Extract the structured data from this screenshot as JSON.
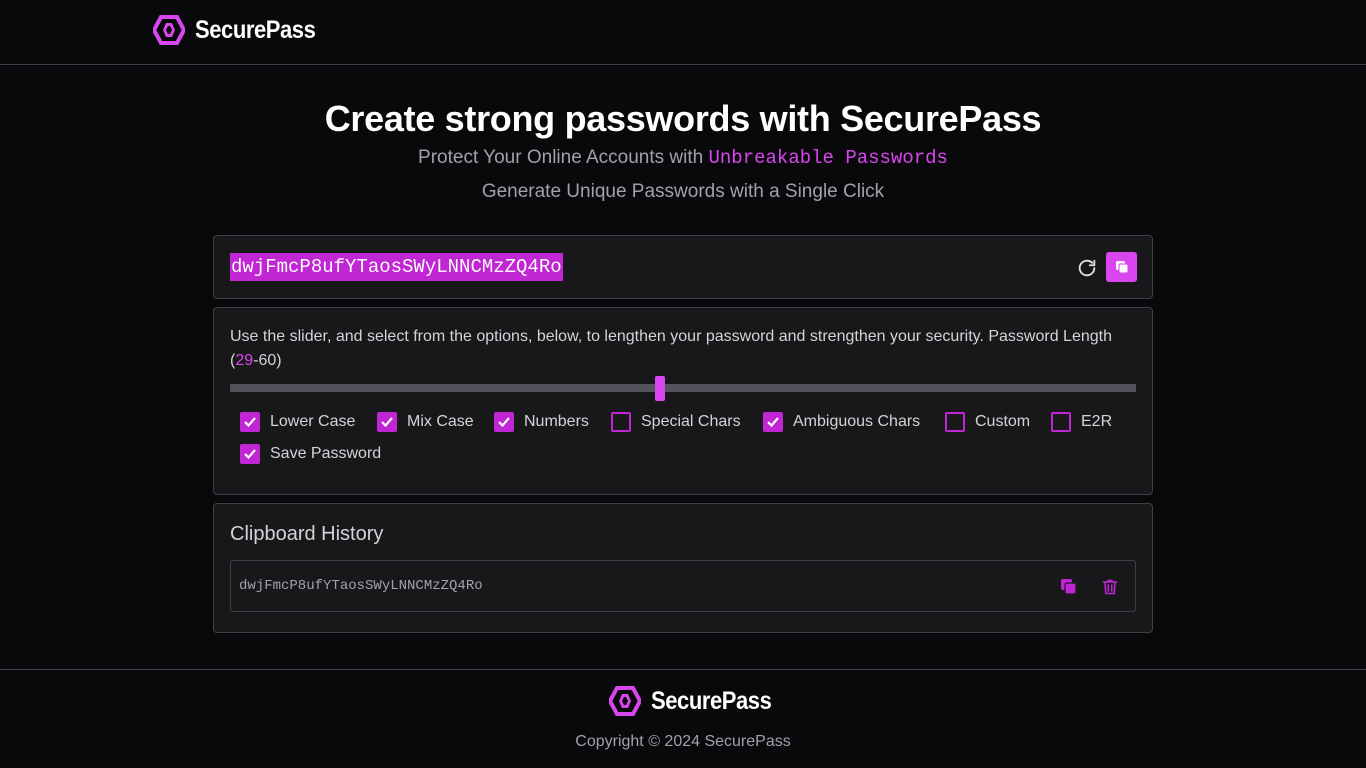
{
  "brand": {
    "name": "SecurePass",
    "accent": "#d946ef"
  },
  "hero": {
    "title": "Create strong passwords with SecurePass",
    "subtitle_prefix": "Protect Your Online Accounts with ",
    "subtitle_accent": "Unbreakable Passwords",
    "subtitle2": "Generate Unique Passwords with a Single Click"
  },
  "generator": {
    "password": "dwjFmcP8ufYTaosSWyLNNCMzZQ4Ro",
    "refresh_icon": "refresh-icon",
    "copy_icon": "copy-icon"
  },
  "options": {
    "description": "Use the slider, and select from the options, below, to lengthen your password and strengthen your security. Password Length (",
    "length_value": "29",
    "length_max_suffix": "-60)",
    "slider": {
      "min": 1,
      "max": 60,
      "value": 29
    },
    "checkboxes": [
      {
        "label": "Lower Case",
        "checked": true
      },
      {
        "label": "Mix Case",
        "checked": true
      },
      {
        "label": "Numbers",
        "checked": true
      },
      {
        "label": "Special Chars",
        "checked": false
      },
      {
        "label": "Ambiguous Chars",
        "checked": true
      },
      {
        "label": "Custom",
        "checked": false
      },
      {
        "label": "E2R",
        "checked": false
      },
      {
        "label": "Save Password",
        "checked": true
      }
    ]
  },
  "history": {
    "title": "Clipboard History",
    "items": [
      {
        "password": "dwjFmcP8ufYTaosSWyLNNCMzZQ4Ro"
      }
    ]
  },
  "footer": {
    "brand": "SecurePass",
    "copyright": "Copyright © 2024 SecurePass"
  }
}
